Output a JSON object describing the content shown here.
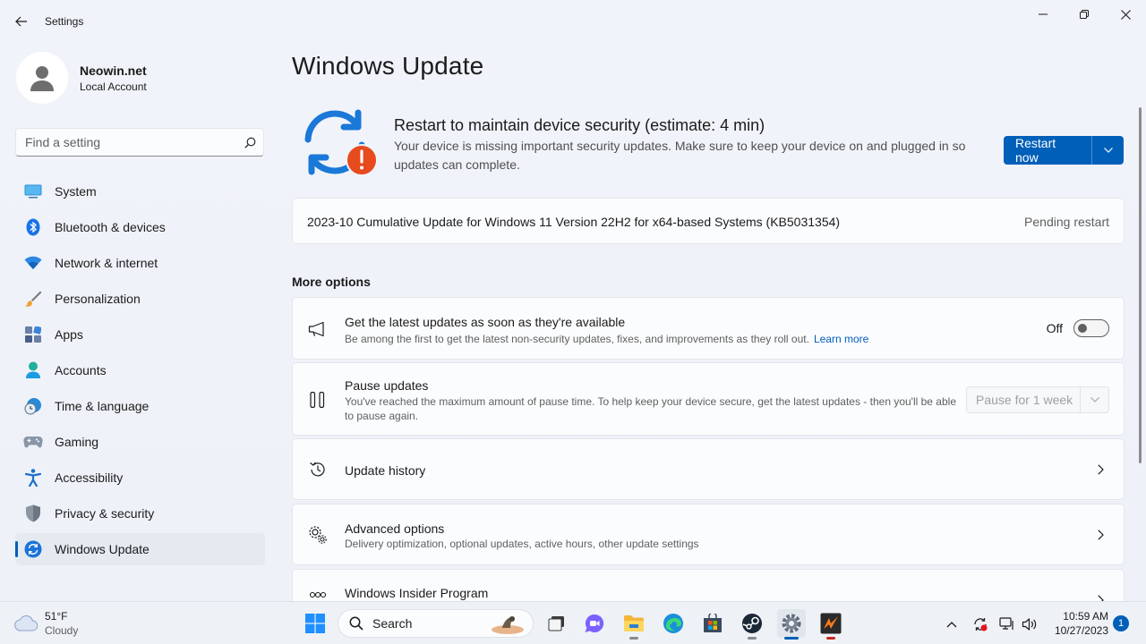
{
  "app": {
    "title": "Settings"
  },
  "profile": {
    "name": "Neowin.net",
    "account_type": "Local Account"
  },
  "search": {
    "placeholder": "Find a setting"
  },
  "sidebar": {
    "items": [
      {
        "label": "System",
        "icon": "system-icon",
        "active": false
      },
      {
        "label": "Bluetooth & devices",
        "icon": "bluetooth-icon",
        "active": false
      },
      {
        "label": "Network & internet",
        "icon": "wifi-icon",
        "active": false
      },
      {
        "label": "Personalization",
        "icon": "brush-icon",
        "active": false
      },
      {
        "label": "Apps",
        "icon": "apps-icon",
        "active": false
      },
      {
        "label": "Accounts",
        "icon": "accounts-icon",
        "active": false
      },
      {
        "label": "Time & language",
        "icon": "time-language-icon",
        "active": false
      },
      {
        "label": "Gaming",
        "icon": "gamepad-icon",
        "active": false
      },
      {
        "label": "Accessibility",
        "icon": "accessibility-icon",
        "active": false
      },
      {
        "label": "Privacy & security",
        "icon": "shield-icon",
        "active": false
      },
      {
        "label": "Windows Update",
        "icon": "windows-update-icon",
        "active": true
      }
    ]
  },
  "main": {
    "title": "Windows Update",
    "hero": {
      "title": "Restart to maintain device security (estimate: 4 min)",
      "description": "Your device is missing important security updates. Make sure to keep your device on and plugged in so updates can complete.",
      "button_label": "Restart now"
    },
    "pending_update": {
      "name": "2023-10 Cumulative Update for Windows 11 Version 22H2 for x64-based Systems (KB5031354)",
      "status": "Pending restart"
    },
    "more_options_title": "More options",
    "options": {
      "latest": {
        "title": "Get the latest updates as soon as they're available",
        "description": "Be among the first to get the latest non-security updates, fixes, and improvements as they roll out.",
        "link": "Learn more",
        "toggle_label": "Off"
      },
      "pause": {
        "title": "Pause updates",
        "description": "You've reached the maximum amount of pause time. To help keep your device secure, get the latest updates - then you'll be able to pause again.",
        "select_value": "Pause for 1 week"
      },
      "history": {
        "title": "Update history"
      },
      "advanced": {
        "title": "Advanced options",
        "description": "Delivery optimization, optional updates, active hours, other update settings"
      },
      "insider": {
        "title": "Windows Insider Program"
      }
    }
  },
  "taskbar": {
    "weather": {
      "temp": "51°F",
      "condition": "Cloudy"
    },
    "search_label": "Search",
    "clock": {
      "time": "10:59 AM",
      "date": "10/27/2023"
    },
    "notification_count": "1"
  },
  "colors": {
    "accent": "#005fb8",
    "alert": "#e74a1c"
  }
}
